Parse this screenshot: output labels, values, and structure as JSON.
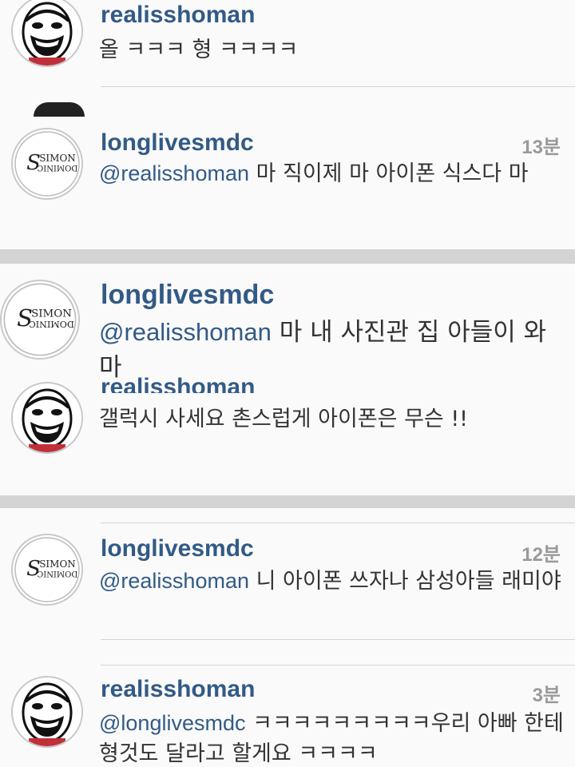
{
  "strip1": {
    "username": "realisshoman",
    "message": "올 ㅋㅋㅋ 형 ㅋㅋㅋㅋ"
  },
  "strip2": {
    "username": "longlivesmdc",
    "time": "13분",
    "mention": "@realisshoman",
    "message": " 마 직이제 마 아이폰 식스다 마"
  },
  "strip3": {
    "username": "longlivesmdc",
    "mention": "@realisshoman",
    "message": " 마 내 사진관 집 아들이 와 마",
    "sub_username": "realisshoman",
    "sub_message": "갤럭시 사세요 촌스럽게 아이폰은 무슨 !!"
  },
  "strip4": {
    "row1": {
      "username": "longlivesmdc",
      "time": "12분",
      "mention": "@realisshoman",
      "message": " 니 아이폰 쓰자나 삼성아들 래미야"
    },
    "row2": {
      "username": "realisshoman",
      "time": "3분",
      "mention": "@longlivesmdc",
      "message": " ㅋㅋㅋㅋㅋㅋㅋㅋㅋ우리 아빠 한테 형것도 달라고 할게요 ㅋㅋㅋㅋ"
    }
  },
  "avatars": {
    "simon_top": "SIMON",
    "simon_bottom": "DOMINIC",
    "simon_monogram": "S"
  },
  "colors": {
    "username": "#325a86",
    "timestamp": "#9a9a9a",
    "text": "#333333",
    "divider": "#d6d6d6",
    "gap": "#d4d4d4"
  }
}
